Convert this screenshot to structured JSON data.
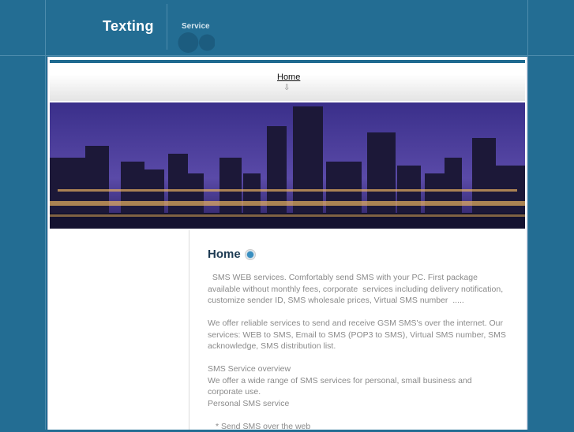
{
  "header": {
    "logo": "Texting",
    "slogan": "Service"
  },
  "nav": {
    "items": [
      {
        "label": "Home"
      }
    ],
    "arrow_icon": "down-arrow-icon"
  },
  "main": {
    "title": "Home",
    "paragraphs": [
      "  SMS WEB services. Comfortably send SMS with your PC. First package available without monthly fees, corporate  services including delivery notification, customize sender ID, SMS wholesale prices, Virtual SMS number  .....",
      "We offer reliable services to send and receive GSM SMS's over the internet. Our services: WEB to SMS, Email to SMS (POP3 to SMS), Virtual SMS number, SMS acknowledge, SMS distribution list."
    ],
    "overview_title": "SMS Service overview",
    "overview_text": "We offer a wide range of SMS services for personal, small business and corporate use.",
    "personal_title": "Personal SMS service",
    "bullet1": "* Send SMS over the web"
  },
  "colors": {
    "background": "#236d93",
    "accent": "#1f6a90",
    "heading": "#1c3a52"
  }
}
